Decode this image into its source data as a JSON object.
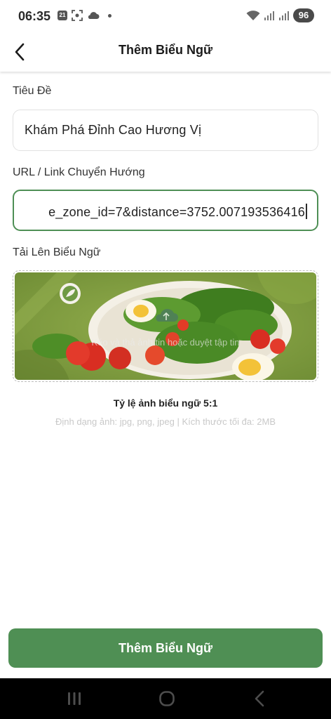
{
  "status_bar": {
    "time": "06:35",
    "notif_badge": "21",
    "battery": "96",
    "icons_left": [
      "calendar-badge-icon",
      "screenshot-icon",
      "cloud-icon",
      "dot-icon"
    ],
    "icons_right": [
      "wifi-icon",
      "signal-icon",
      "signal-icon",
      "battery-icon"
    ]
  },
  "header": {
    "title": "Thêm Biểu Ngữ",
    "back_icon": "chevron-left-icon"
  },
  "form": {
    "title_label": "Tiêu Đề",
    "title_value": "Khám Phá Đỉnh Cao Hương Vị",
    "url_label": "URL / Link Chuyển Hướng",
    "url_value": "e_zone_id=7&distance=3752.007193536416",
    "upload_label": "Tải Lên Biểu Ngữ",
    "upload_hint": "Kéo và thả ảnh tin hoặc duyệt tập tin",
    "upload_icon": "cloud-upload-icon",
    "ratio_text": "Tỷ lệ ảnh biểu ngữ 5:1",
    "format_text": "Định dạng ảnh: jpg, png, jpeg | Kích thước tối đa: 2MB"
  },
  "colors": {
    "accent": "#4f8f54",
    "banner_bg": "#7e9c3e"
  },
  "submit": {
    "label": "Thêm Biểu Ngữ"
  },
  "nav": {
    "icons": [
      "recent-apps-icon",
      "home-icon",
      "back-icon"
    ]
  }
}
